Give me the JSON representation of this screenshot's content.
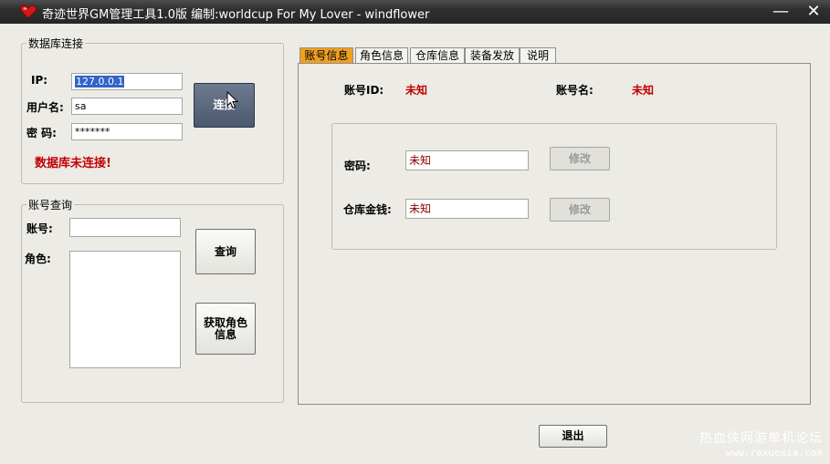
{
  "window": {
    "title": "奇迹世界GM管理工具1.0版  编制:worldcup For My Lover - windflower",
    "minimize": "—",
    "close": "✕"
  },
  "db": {
    "legend": "数据库连接",
    "ip_label": "IP:",
    "ip_value": "127.0.0.1",
    "user_label": "用户名:",
    "user_value": "sa",
    "pwd_label": "密  码:",
    "pwd_value": "*******",
    "connect_button": "连接",
    "status": "数据库未连接!"
  },
  "account_query": {
    "legend": "账号查询",
    "account_label": "账号:",
    "account_value": "",
    "role_label": "角色:",
    "query_button": "查询",
    "get_role_button_line1": "获取角色",
    "get_role_button_line2": "信息"
  },
  "tabs": [
    "账号信息",
    "角色信息",
    "仓库信息",
    "装备发放",
    "说明"
  ],
  "account_info": {
    "id_label": "账号ID:",
    "id_value": "未知",
    "name_label": "账号名:",
    "name_value": "未知",
    "pwd_label": "密码:",
    "pwd_value": "未知",
    "pwd_modify": "修改",
    "money_label": "仓库金钱:",
    "money_value": "未知",
    "money_modify": "修改"
  },
  "exit_button": "退出",
  "watermark": {
    "line1": "热血侠网游单机论坛",
    "line2": "www.rexuexia.com"
  },
  "colors": {
    "titlebar": "#2f2f2f",
    "active_tab": "#f0a020",
    "status_red": "#c00000",
    "connect_button": "#5b677d"
  }
}
